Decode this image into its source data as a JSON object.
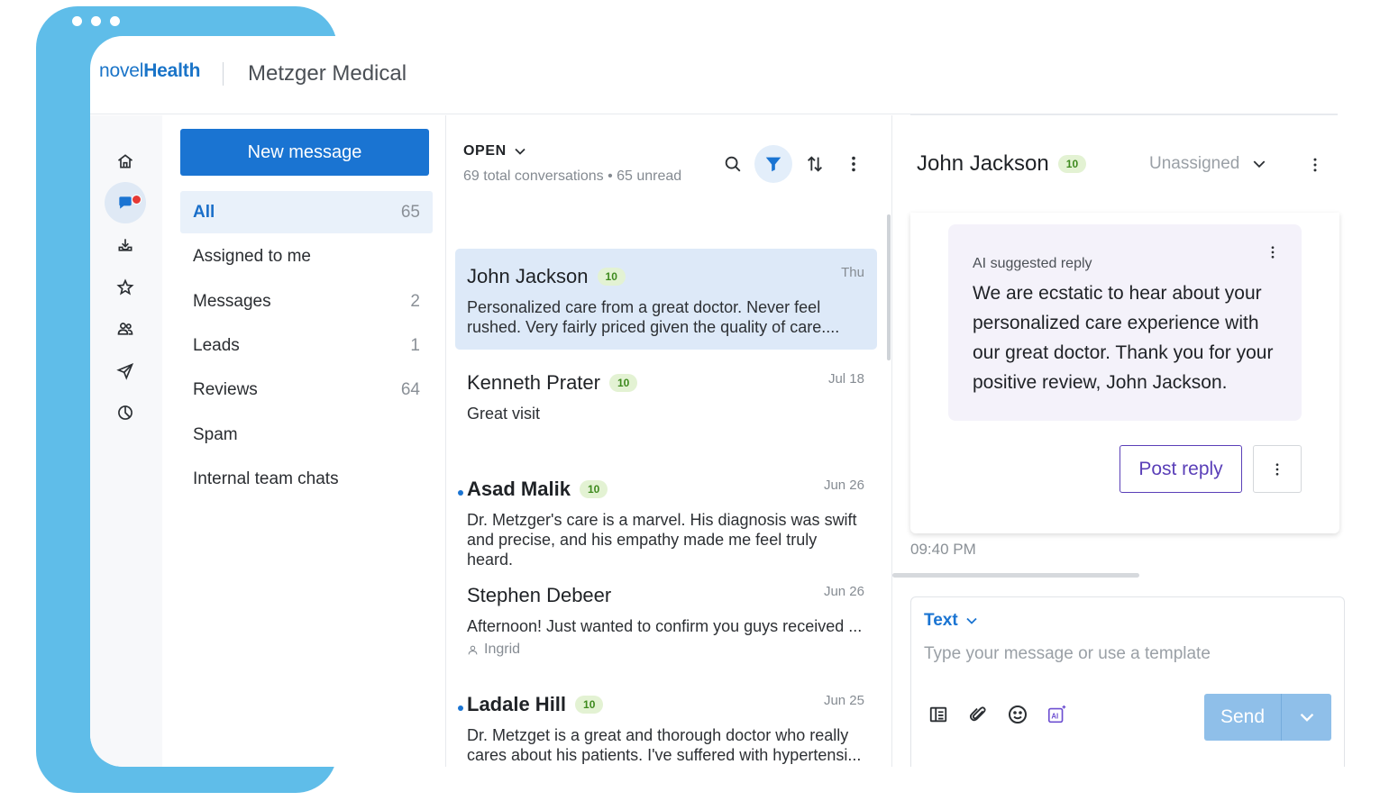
{
  "header": {
    "brand_part1": "novel",
    "brand_part2": "Health",
    "org_name": "Metzger Medical"
  },
  "rail": {
    "items": [
      "home-icon",
      "chat-icon",
      "inbox-tray-icon",
      "star-icon",
      "people-icon",
      "send-icon",
      "analytics-icon"
    ],
    "active_index": 1
  },
  "folders": {
    "new_message_label": "New message",
    "items": [
      {
        "label": "All",
        "count": "65",
        "active": true
      },
      {
        "label": "Assigned to me",
        "count": ""
      },
      {
        "label": "Messages",
        "count": "2"
      },
      {
        "label": "Leads",
        "count": "1"
      },
      {
        "label": "Reviews",
        "count": "64"
      },
      {
        "label": "Spam",
        "count": ""
      },
      {
        "label": "Internal team chats",
        "count": ""
      }
    ]
  },
  "list": {
    "status_label": "OPEN",
    "summary": "69 total conversations • 65 unread",
    "conversations": [
      {
        "name": "John Jackson",
        "badge": "10",
        "date": "Thu",
        "preview": "Personalized care from a great doctor. Never feel rushed. Very fairly priced given the quality of care....",
        "selected": true,
        "unread": false
      },
      {
        "name": "Kenneth Prater",
        "badge": "10",
        "date": "Jul 18",
        "preview": "Great visit",
        "unread": false
      },
      {
        "name": "Asad Malik",
        "badge": "10",
        "date": "Jun 26",
        "preview": "Dr. Metzger's care is a marvel. His diagnosis was swift and precise, and his empathy made me feel truly heard.",
        "unread": true
      },
      {
        "name": "Stephen Debeer",
        "badge": "",
        "date": "Jun 26",
        "preview": "Afternoon! Just wanted to confirm you guys received ...",
        "assignee": "Ingrid",
        "unread": false
      },
      {
        "name": "Ladale Hill",
        "badge": "10",
        "date": "Jun 25",
        "preview": "Dr. Metzget is a great and thorough doctor who really cares about his patients. I've suffered with hypertensi...",
        "unread": true
      }
    ]
  },
  "detail": {
    "name": "John Jackson",
    "badge": "10",
    "assign_label": "Unassigned",
    "ai_label": "AI suggested reply",
    "ai_text": "We are ecstatic to hear about your personalized care experience with our great doctor. Thank you for your positive review, John Jackson.",
    "post_reply_label": "Post reply",
    "time": "09:40 PM",
    "composer": {
      "type_label": "Text",
      "placeholder": "Type your message or use a template",
      "send_label": "Send"
    }
  },
  "colors": {
    "frame": "#5fbde9",
    "primary": "#1a74d2",
    "accent_purple": "#5a3fb8",
    "badge_bg": "#e3f2d3",
    "badge_text": "#3e8a1e",
    "notification": "#e53935"
  }
}
